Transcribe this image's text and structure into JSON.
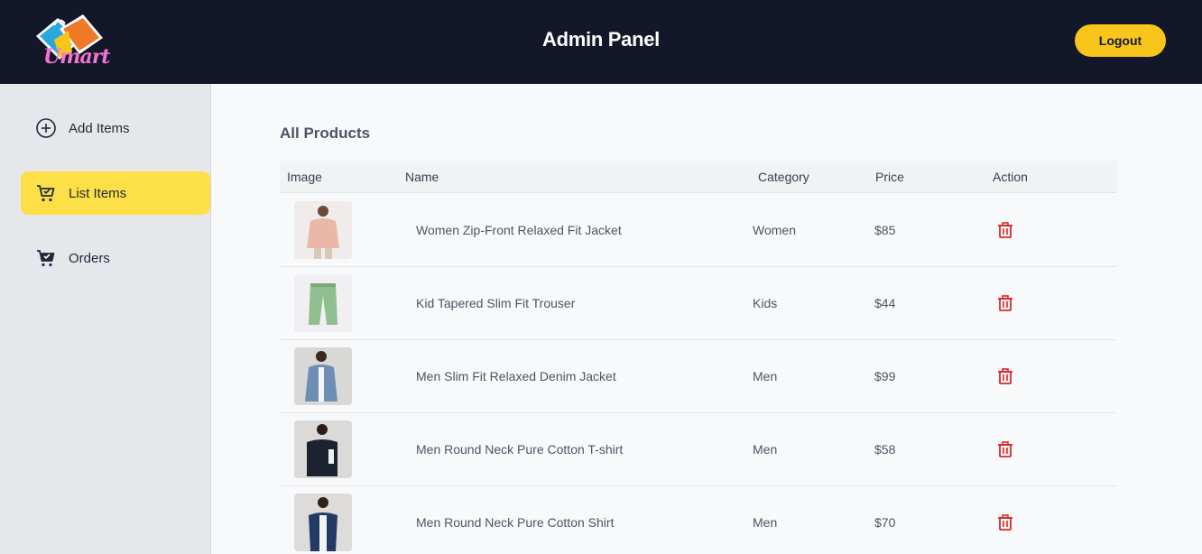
{
  "header": {
    "logo_text": "Umart",
    "title": "Admin Panel",
    "logout_label": "Logout"
  },
  "sidebar": {
    "items": [
      {
        "label": "Add Items",
        "icon": "plus-circle-icon",
        "active": false
      },
      {
        "label": "List Items",
        "icon": "cart-icon",
        "active": true
      },
      {
        "label": "Orders",
        "icon": "cart-check-icon",
        "active": false
      }
    ]
  },
  "main": {
    "title": "All Products",
    "columns": [
      "Image",
      "Name",
      "Category",
      "Price",
      "Action"
    ],
    "products": [
      {
        "name": "Women Zip-Front Relaxed Fit Jacket",
        "category": "Women",
        "price": "$85",
        "image": "pink-jacket-photo"
      },
      {
        "name": "Kid Tapered Slim Fit Trouser",
        "category": "Kids",
        "price": "$44",
        "image": "green-trouser-photo"
      },
      {
        "name": "Men Slim Fit Relaxed Denim Jacket",
        "category": "Men",
        "price": "$99",
        "image": "denim-jacket-photo"
      },
      {
        "name": "Men Round Neck Pure Cotton T-shirt",
        "category": "Men",
        "price": "$58",
        "image": "black-tshirt-photo"
      },
      {
        "name": "Men Round Neck Pure Cotton Shirt",
        "category": "Men",
        "price": "$70",
        "image": "navy-shirt-photo"
      }
    ]
  },
  "colors": {
    "header_bg": "#121829",
    "accent": "#f8c61b",
    "active_nav": "#fde047",
    "delete": "#dc2626"
  }
}
